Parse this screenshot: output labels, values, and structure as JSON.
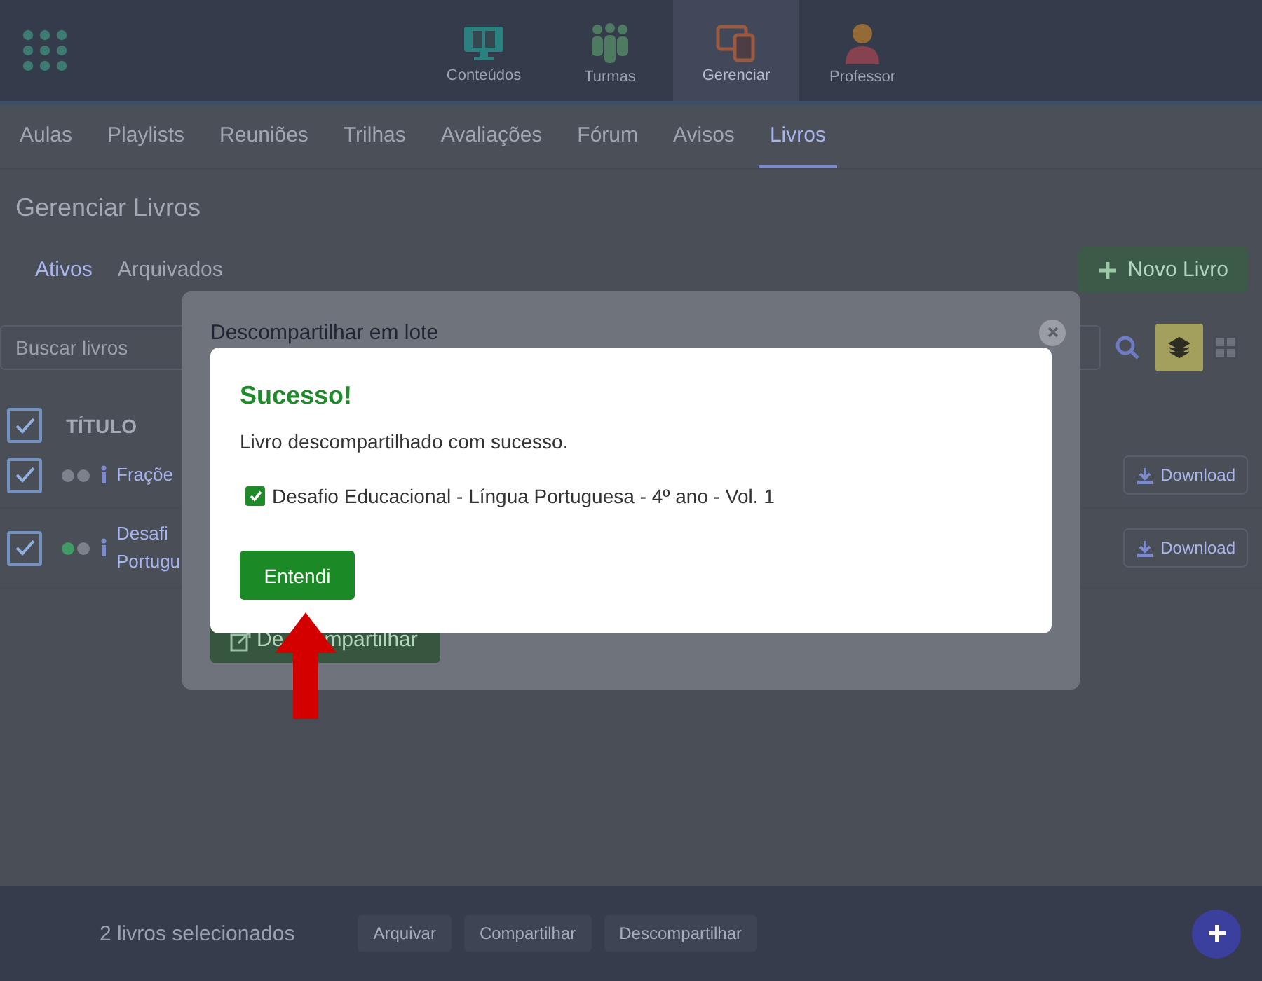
{
  "top_nav": [
    {
      "label": "Conteúdos",
      "selected": false
    },
    {
      "label": "Turmas",
      "selected": false
    },
    {
      "label": "Gerenciar",
      "selected": true
    },
    {
      "label": "Professor",
      "selected": false
    }
  ],
  "sub_nav": [
    {
      "label": "Aulas",
      "selected": false
    },
    {
      "label": "Playlists",
      "selected": false
    },
    {
      "label": "Reuniões",
      "selected": false
    },
    {
      "label": "Trilhas",
      "selected": false
    },
    {
      "label": "Avaliações",
      "selected": false
    },
    {
      "label": "Fórum",
      "selected": false
    },
    {
      "label": "Avisos",
      "selected": false
    },
    {
      "label": "Livros",
      "selected": true
    }
  ],
  "page_title": "Gerenciar Livros",
  "status_tabs": [
    {
      "label": "Ativos",
      "selected": true
    },
    {
      "label": "Arquivados",
      "selected": false
    }
  ],
  "new_button": "Novo Livro",
  "search": {
    "placeholder": "Buscar livros"
  },
  "table": {
    "header_checked": true,
    "column_title": "TÍTULO",
    "rows": [
      {
        "checked": true,
        "dots": [
          {
            "color": "#7c818b"
          },
          {
            "color": "#7c818b"
          }
        ],
        "title_lines": [
          "Fraçõe"
        ],
        "download": "Download"
      },
      {
        "checked": true,
        "dots": [
          {
            "color": "#3f9a63"
          },
          {
            "color": "#7c818b"
          }
        ],
        "title_lines": [
          "Desafi",
          "Portugu"
        ],
        "download": "Download"
      }
    ]
  },
  "batch_modal": {
    "title": "Descompartilhar em lote",
    "button_parts": [
      "De",
      "mpartilhar"
    ]
  },
  "success_dialog": {
    "title": "Sucesso!",
    "message": "Livro descompartilhado com sucesso.",
    "items": [
      {
        "label": "Desafio Educacional - Língua Portuguesa - 4º ano - Vol. 1",
        "checked": true
      }
    ],
    "button": "Entendi"
  },
  "bottom_bar": {
    "selection_count": "2 livros selecionados",
    "actions": [
      "Arquivar",
      "Compartilhar",
      "Descompartilhar"
    ]
  }
}
